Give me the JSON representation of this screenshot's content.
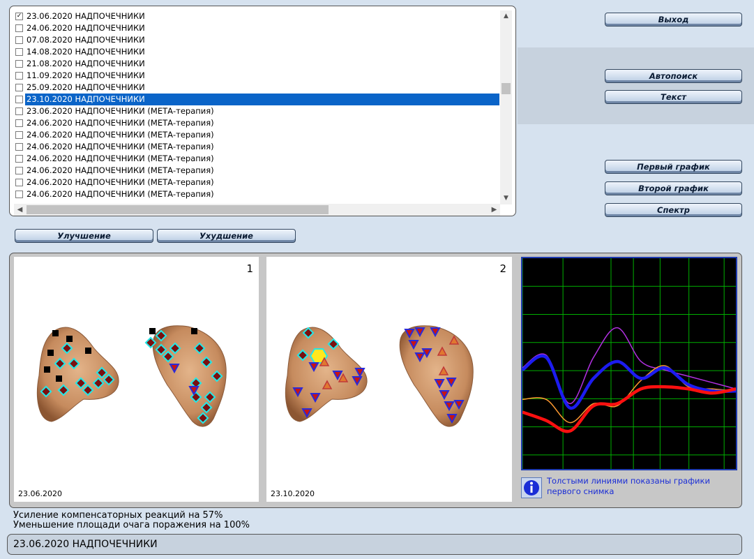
{
  "list": {
    "items": [
      {
        "checked": true,
        "selected": false,
        "label": "23.06.2020  НАДПОЧЕЧНИКИ"
      },
      {
        "checked": false,
        "selected": false,
        "label": "24.06.2020  НАДПОЧЕЧНИКИ"
      },
      {
        "checked": false,
        "selected": false,
        "label": "07.08.2020  НАДПОЧЕЧНИКИ"
      },
      {
        "checked": false,
        "selected": false,
        "label": "14.08.2020  НАДПОЧЕЧНИКИ"
      },
      {
        "checked": false,
        "selected": false,
        "label": "21.08.2020  НАДПОЧЕЧНИКИ"
      },
      {
        "checked": false,
        "selected": false,
        "label": "11.09.2020  НАДПОЧЕЧНИКИ"
      },
      {
        "checked": false,
        "selected": false,
        "label": "25.09.2020  НАДПОЧЕЧНИКИ"
      },
      {
        "checked": false,
        "selected": true,
        "label": "23.10.2020  НАДПОЧЕЧНИКИ"
      },
      {
        "checked": false,
        "selected": false,
        "label": "23.06.2020  НАДПОЧЕЧНИКИ  (МЕТА-терапия)"
      },
      {
        "checked": false,
        "selected": false,
        "label": "24.06.2020  НАДПОЧЕЧНИКИ  (МЕТА-терапия)"
      },
      {
        "checked": false,
        "selected": false,
        "label": "24.06.2020  НАДПОЧЕЧНИКИ  (МЕТА-терапия)"
      },
      {
        "checked": false,
        "selected": false,
        "label": "24.06.2020  НАДПОЧЕЧНИКИ  (МЕТА-терапия)"
      },
      {
        "checked": false,
        "selected": false,
        "label": "24.06.2020  НАДПОЧЕЧНИКИ  (МЕТА-терапия)"
      },
      {
        "checked": false,
        "selected": false,
        "label": "24.06.2020  НАДПОЧЕЧНИКИ  (МЕТА-терапия)"
      },
      {
        "checked": false,
        "selected": false,
        "label": "24.06.2020  НАДПОЧЕЧНИКИ  (МЕТА-терапия)"
      },
      {
        "checked": false,
        "selected": false,
        "label": "24.06.2020  НАДПОЧЕЧНИКИ  (МЕТА-терапия)"
      }
    ]
  },
  "buttons": {
    "exit": "Выход",
    "autosearch": "Автопоиск",
    "text": "Текст",
    "first_chart": "Первый график",
    "second_chart": "Второй график",
    "spectrum": "Спектр",
    "improvement": "Улучшение",
    "worsening": "Ухудшение"
  },
  "images": [
    {
      "number": "1",
      "date": "23.06.2020"
    },
    {
      "number": "2",
      "date": "23.10.2020"
    }
  ],
  "info": {
    "text": "Толстыми линиями показаны графики первого снимка"
  },
  "results": {
    "line1": "Усиление компенсаторных реакций на 57%",
    "line2": "Уменьшение площади очага поражения на 100%"
  },
  "status": {
    "text": "23.06.2020 НАДПОЧЕЧНИКИ"
  },
  "colors": {
    "chart_bg": "#000000",
    "grid": "#00b000",
    "first_blue": "#1c1cf0",
    "first_red": "#ff1010",
    "second_purple": "#b030e0",
    "second_orange": "#ff9a30",
    "selection": "#0a64c8"
  },
  "chart_data": {
    "type": "line",
    "x": [
      0,
      1,
      2,
      3,
      4,
      5,
      6,
      7,
      8,
      9
    ],
    "series": [
      {
        "values": [
          47,
          53,
          29,
          43,
          51,
          43,
          48,
          40,
          37,
          37
        ],
        "color": "#1c1cf0",
        "thick": true
      },
      {
        "values": [
          27,
          23,
          18,
          30,
          31,
          38,
          39,
          38,
          36,
          38
        ],
        "color": "#ff1010",
        "thick": true
      },
      {
        "values": [
          48,
          54,
          31,
          53,
          67,
          51,
          47,
          44,
          41,
          38
        ],
        "color": "#b030e0",
        "thick": false
      },
      {
        "values": [
          33,
          33,
          22,
          31,
          30,
          42,
          49,
          39,
          38,
          37
        ],
        "color": "#ff9a30",
        "thick": false
      }
    ],
    "ylim": [
      0,
      100
    ],
    "grid": true
  }
}
